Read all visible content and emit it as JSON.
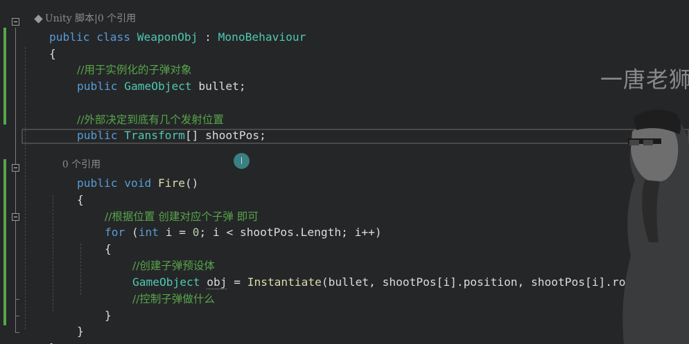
{
  "codelens": {
    "unity_label": "Unity 脚本",
    "class_refs": "0 个引用",
    "method_refs": "0 个引用"
  },
  "code": {
    "class_public": "public",
    "class_kw": "class",
    "class_name": "WeaponObj",
    "class_colon": " : ",
    "base_class": "MonoBehaviour",
    "open_brace": "{",
    "comment_bullet": "//用于实例化的子弹对象",
    "bullet_public": "public",
    "bullet_type": "GameObject",
    "bullet_name": " bullet;",
    "comment_pos": "//外部决定到底有几个发射位置",
    "pos_public": "public",
    "pos_type": "Transform",
    "pos_name": "[] shootPos;",
    "fire_public": "public",
    "fire_void": "void",
    "fire_name": "Fire",
    "fire_parens": "()",
    "fire_open": "{",
    "comment_create": "//根据位置 创建对应个子弹 即可",
    "for_kw": "for",
    "for_paren": " (",
    "for_int": "int",
    "for_i_eq": " i = ",
    "for_zero": "0",
    "for_rest": "; i < shootPos.Length; i++)",
    "loop_open": "{",
    "comment_prefab": "//创建子弹预设体",
    "inst_type": "GameObject",
    "inst_var": "obj",
    "inst_eq": " = ",
    "inst_fn": "Instantiate",
    "inst_args": "(bullet, shootPos[i].position, shootPos[i].rotation);",
    "comment_what": "//控制子弹做什么",
    "loop_close": "}",
    "fire_close": "}",
    "class_close": "}"
  },
  "watermark": "一唐老狮",
  "colors": {
    "background": "#252628",
    "keyword": "#569cd6",
    "type": "#4ec9b0",
    "comment": "#57a64a",
    "method": "#dcdcaa",
    "number": "#b5cea8",
    "plain": "#dcdcdc"
  }
}
